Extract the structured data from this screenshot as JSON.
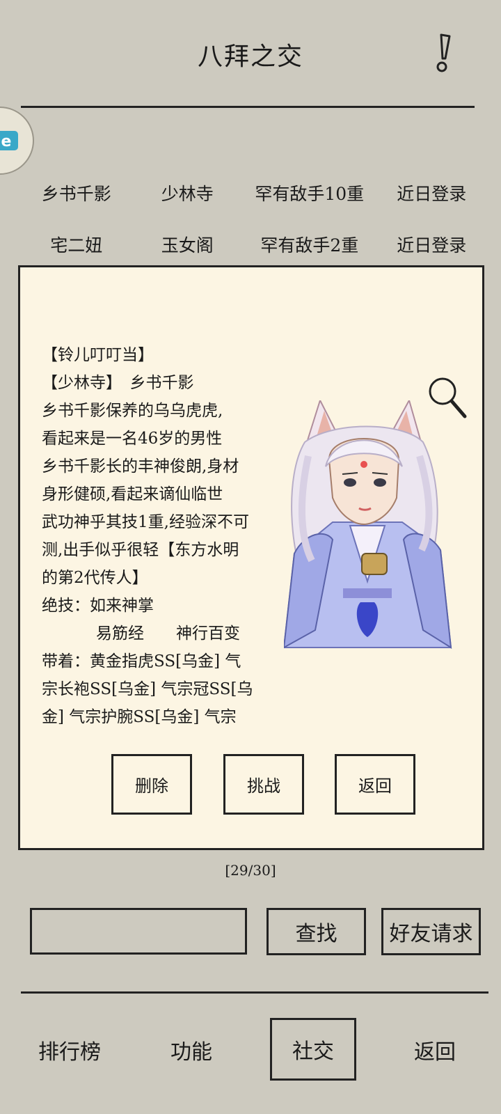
{
  "header": {
    "title": "八拜之交"
  },
  "friends": [
    [
      "乡书千影",
      "少林寺",
      "罕有敌手10重",
      "近日登录"
    ],
    [
      "宅二妞",
      "玉女阁",
      "罕有敌手2重",
      "近日登录"
    ]
  ],
  "detail": {
    "lines": [
      "【铃儿叮叮当】",
      "【少林寺】　乡书千影",
      "乡书千影保养的乌乌虎虎,",
      "看起来是一名46岁的男性",
      "乡书千影长的丰神俊朗,身材",
      "身形健硕,看起来谪仙临世",
      "武功神乎其技1重,经验深不可",
      "测,出手似乎很轻【东方水明",
      "的第2代传人】",
      "绝技：如来神掌",
      "易筋经　　神行百变",
      "带着：黄金指虎SS[乌金] 气",
      "宗长袍SS[乌金] 气宗冠SS[乌",
      "金] 气宗护腕SS[乌金] 气宗"
    ],
    "buttons": [
      "删除",
      "挑战",
      "返回"
    ]
  },
  "counter": "[29/30]",
  "search": {
    "value": "",
    "placeholder": "",
    "find_label": "查找",
    "request_label": "好友请求"
  },
  "nav": [
    "排行榜",
    "功能",
    "社交",
    "返回"
  ],
  "colors": {
    "background": "#cdcabf",
    "panel": "#fcf5e3",
    "ink": "#222222"
  }
}
